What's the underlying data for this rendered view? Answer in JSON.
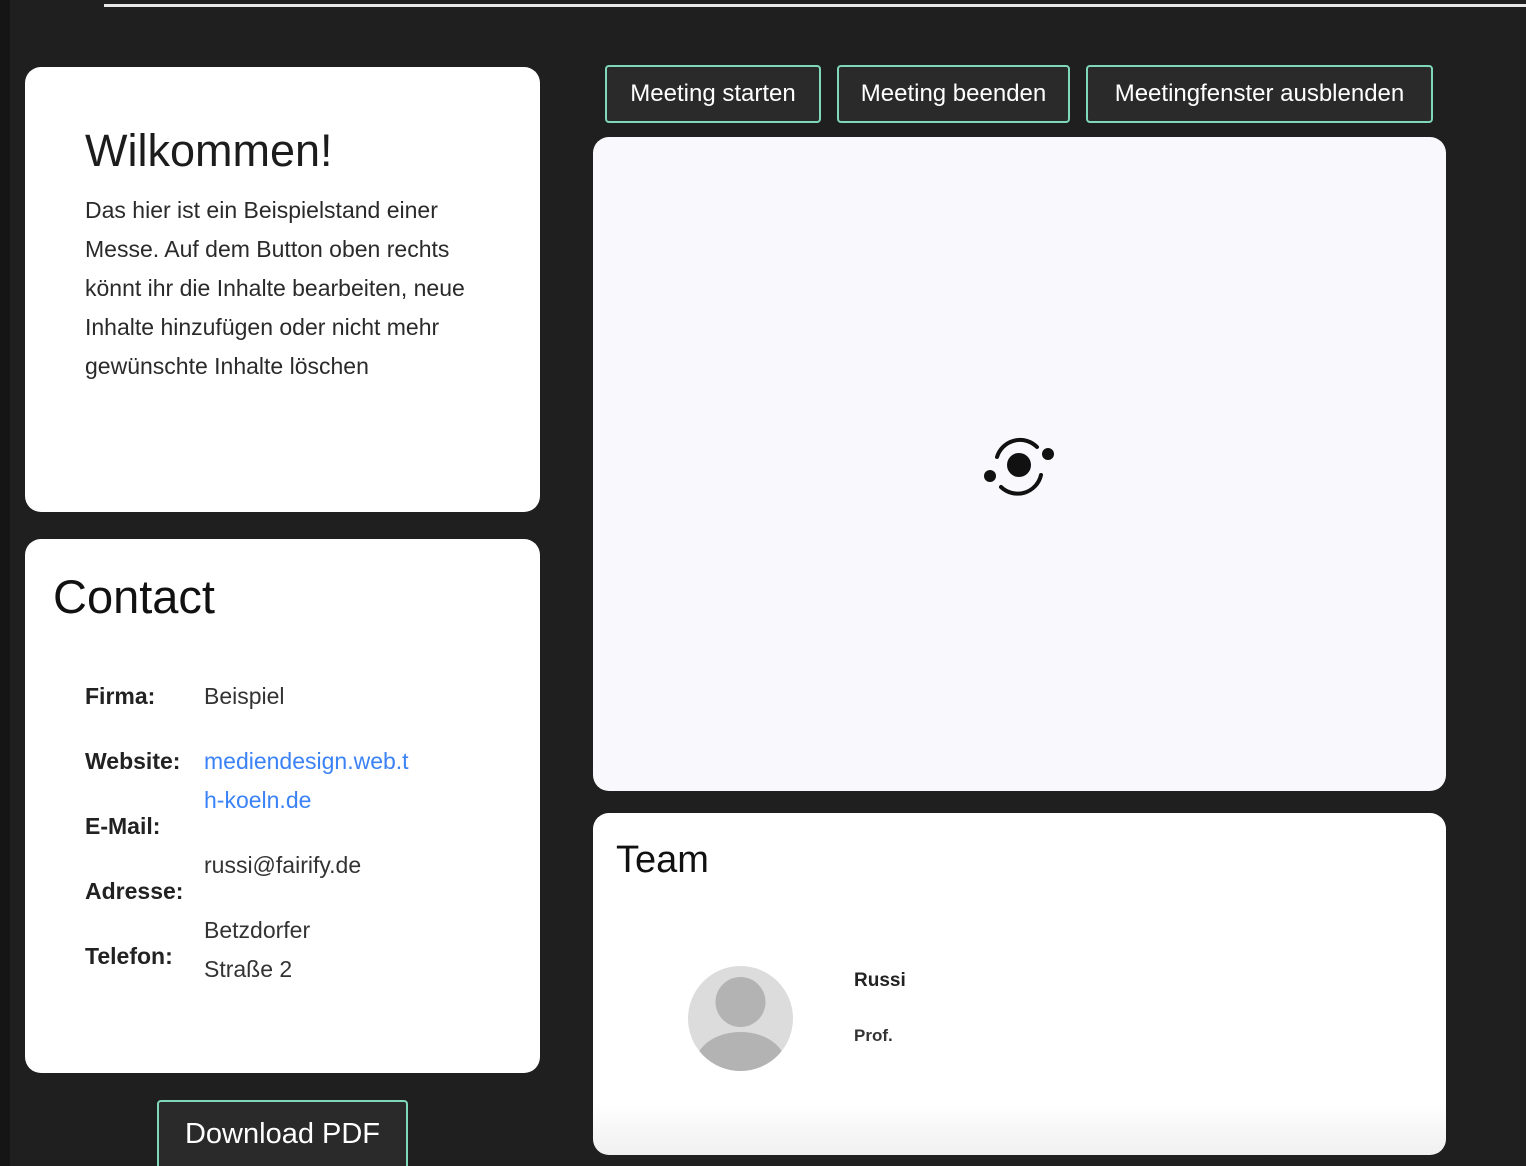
{
  "toolbar": {
    "start_meeting": "Meeting starten",
    "end_meeting": "Meeting beenden",
    "hide_meeting_window": "Meetingfenster ausblenden"
  },
  "welcome": {
    "title": "Wilkommen!",
    "text": "Das hier ist ein Beispielstand einer Messe. Auf dem Button oben rechts könnt ihr die Inhalte bearbeiten, neue Inhalte hinzufügen oder nicht mehr gewünschte Inhalte löschen"
  },
  "contact": {
    "title": "Contact",
    "company_label": "Firma:",
    "company": "Beispiel",
    "website_label": "Website:",
    "website": "mediendesign.web.th-koeln.de",
    "email_label": "E-Mail:",
    "email": "russi@fairify.de",
    "address_label": "Adresse:",
    "address": "Betzdorfer Straße 2",
    "phone_label": "Telefon:"
  },
  "download": {
    "label": "Download PDF"
  },
  "meeting": {
    "loader_icon": "loading-spinner-icon"
  },
  "team": {
    "title": "Team",
    "members": [
      {
        "name": "Russi",
        "title": "Prof.",
        "avatar_icon": "user-avatar-icon"
      }
    ]
  },
  "colors": {
    "background": "#1f1f1f",
    "button_border": "#7fd8b8",
    "link": "#3b82f6",
    "card": "#ffffff"
  }
}
